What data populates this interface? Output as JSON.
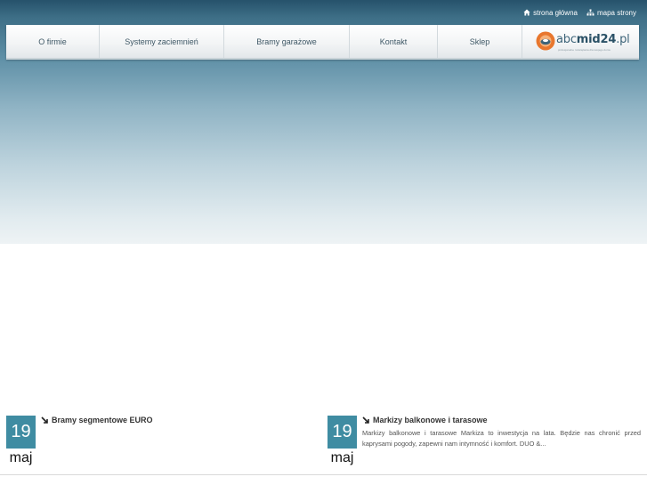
{
  "toplinks": [
    {
      "label": "strona główna",
      "icon": "home-icon"
    },
    {
      "label": "mapa strony",
      "icon": "sitemap-icon"
    }
  ],
  "nav": {
    "items": [
      {
        "label": "O firmie"
      },
      {
        "label": "Systemy zaciemnień"
      },
      {
        "label": "Bramy garażowe"
      },
      {
        "label": "Kontakt"
      },
      {
        "label": "Sklep"
      }
    ],
    "logo": {
      "part1": "abc",
      "part2": "mid24",
      "part3": ".pl",
      "tagline": "profesjonalne rozwiązania dla twojego domu"
    }
  },
  "news": [
    {
      "day": "19",
      "month": "maj",
      "title": "Bramy segmentowe EURO",
      "text": ""
    },
    {
      "day": "19",
      "month": "maj",
      "title": "Markizy balkonowe i tarasowe",
      "text": "Markizy balkonowe i tarasowe Markiza to inwestycja na lata. Będzie nas chronić przed kaprysami pogody, zapewni nam intymność i komfort.  DUO          &..."
    }
  ],
  "colors": {
    "accent": "#3f8ca2",
    "header_dark": "#26526b",
    "logo_orange": "#e8772e"
  }
}
